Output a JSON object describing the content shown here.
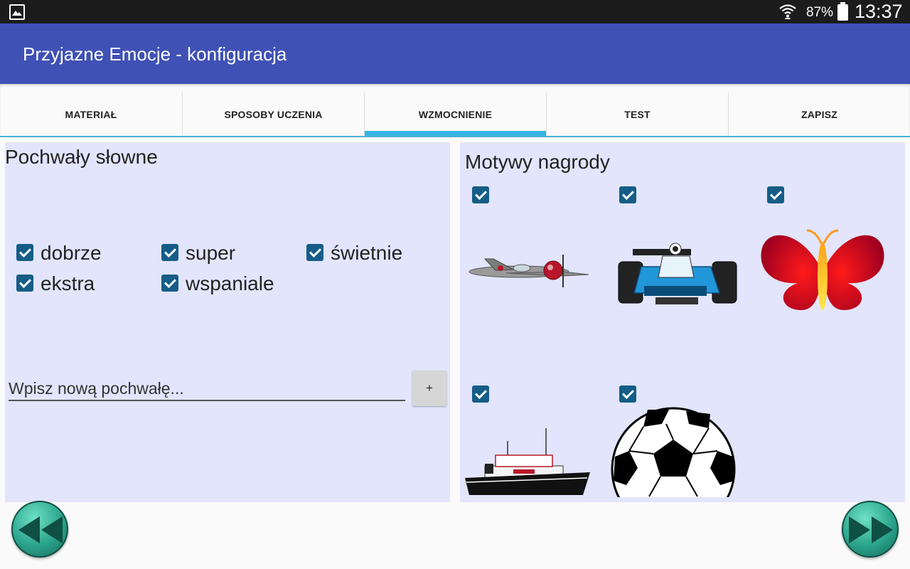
{
  "status_bar": {
    "battery": "87%",
    "time": "13:37"
  },
  "app_bar": {
    "title": "Przyjazne Emocje - konfiguracja"
  },
  "tabs": [
    {
      "label": "MATERIAŁ",
      "selected": false
    },
    {
      "label": "SPOSOBY UCZENIA",
      "selected": false
    },
    {
      "label": "WZMOCNIENIE",
      "selected": true
    },
    {
      "label": "TEST",
      "selected": false
    },
    {
      "label": "ZAPISZ",
      "selected": false
    }
  ],
  "verbal_praise": {
    "heading": "Pochwały słowne",
    "items": [
      {
        "label": "dobrze",
        "checked": true
      },
      {
        "label": "super",
        "checked": true
      },
      {
        "label": "świetnie",
        "checked": true
      },
      {
        "label": "ekstra",
        "checked": true
      },
      {
        "label": "wspaniale",
        "checked": true
      }
    ],
    "input_placeholder": "Wpisz nową pochwałę...",
    "add_button": "+"
  },
  "reward_motifs": {
    "heading": "Motywy nagrody",
    "items": [
      {
        "icon": "airplane-icon",
        "checked": true
      },
      {
        "icon": "race-car-icon",
        "checked": true
      },
      {
        "icon": "butterfly-icon",
        "checked": true
      },
      {
        "icon": "ship-icon",
        "checked": true
      },
      {
        "icon": "soccer-ball-icon",
        "checked": true
      }
    ]
  },
  "colors": {
    "app_bar": "#3f51b5",
    "tab_indicator": "#39b3e6",
    "panel": "#e2e5fc",
    "checkbox": "#155d87",
    "nav_button": "#2aa48b"
  }
}
